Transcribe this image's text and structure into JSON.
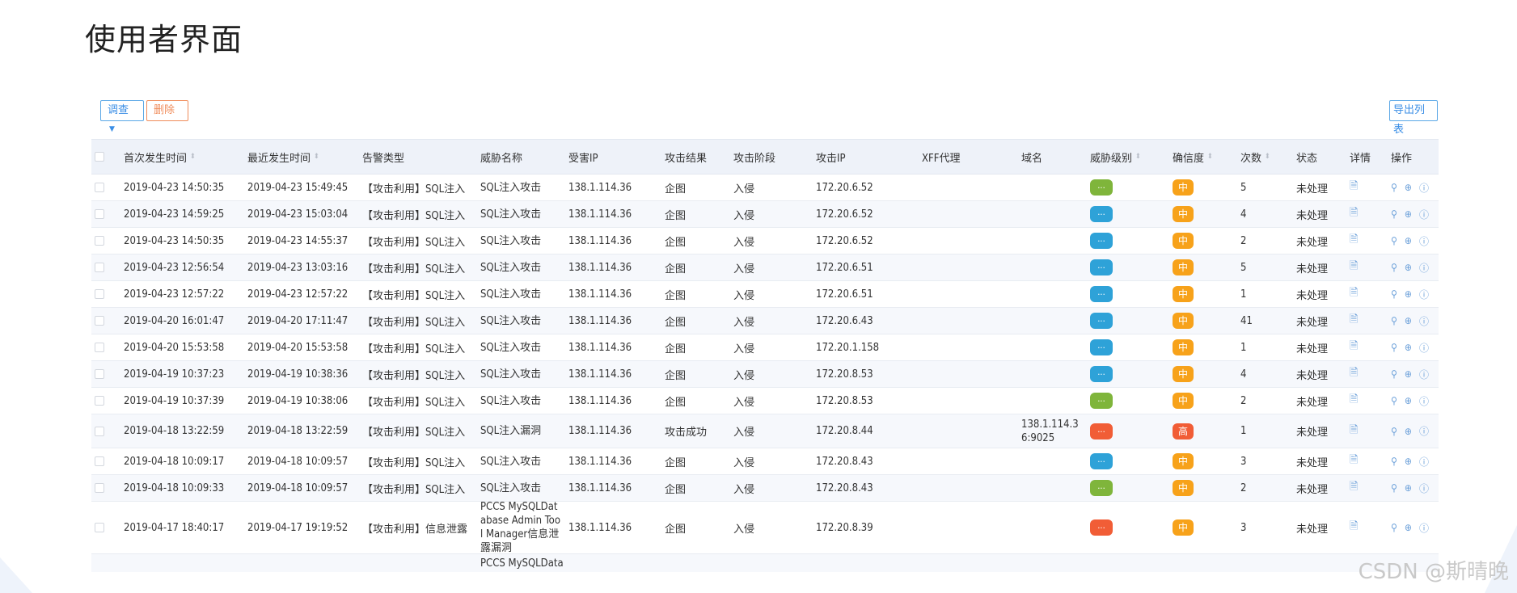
{
  "page_title": "使用者界面",
  "toolbar": {
    "investigate_label": "调查",
    "investigate_caret": "▼",
    "delete_label": "删除",
    "export_label": "导出列表"
  },
  "columns": [
    "首次发生时间",
    "最近发生时间",
    "告警类型",
    "威胁名称",
    "受害IP",
    "攻击结果",
    "攻击阶段",
    "攻击IP",
    "XFF代理",
    "域名",
    "威胁级别",
    "确信度",
    "次数",
    "状态",
    "详情",
    "操作"
  ],
  "colors": {
    "green": "#7fb53b",
    "blue": "#2ea2d8",
    "red": "#f15d36",
    "orange": "#f7a21a",
    "icon": "#6a9fd9"
  },
  "icons": {
    "detail": "document-icon",
    "operations": [
      "search-icon",
      "add-icon",
      "info-icon"
    ]
  },
  "rows": [
    {
      "first": "2019-04-23 14:50:35",
      "last": "2019-04-23 15:49:45",
      "type": "【攻击利用】SQL注入",
      "name": "SQL注入攻击",
      "victim_ip": "138.1.114.36",
      "result": "企图",
      "stage": "入侵",
      "attack_ip": "172.20.6.52",
      "xff": "",
      "domain": "",
      "threat": "...",
      "threat_color": "green",
      "confidence": "中",
      "conf_color": "orange",
      "count": "5",
      "status": "未处理"
    },
    {
      "first": "2019-04-23 14:59:25",
      "last": "2019-04-23 15:03:04",
      "type": "【攻击利用】SQL注入",
      "name": "SQL注入攻击",
      "victim_ip": "138.1.114.36",
      "result": "企图",
      "stage": "入侵",
      "attack_ip": "172.20.6.52",
      "xff": "",
      "domain": "",
      "threat": "...",
      "threat_color": "blue",
      "confidence": "中",
      "conf_color": "orange",
      "count": "4",
      "status": "未处理"
    },
    {
      "first": "2019-04-23 14:50:35",
      "last": "2019-04-23 14:55:37",
      "type": "【攻击利用】SQL注入",
      "name": "SQL注入攻击",
      "victim_ip": "138.1.114.36",
      "result": "企图",
      "stage": "入侵",
      "attack_ip": "172.20.6.52",
      "xff": "",
      "domain": "",
      "threat": "...",
      "threat_color": "blue",
      "confidence": "中",
      "conf_color": "orange",
      "count": "2",
      "status": "未处理"
    },
    {
      "first": "2019-04-23 12:56:54",
      "last": "2019-04-23 13:03:16",
      "type": "【攻击利用】SQL注入",
      "name": "SQL注入攻击",
      "victim_ip": "138.1.114.36",
      "result": "企图",
      "stage": "入侵",
      "attack_ip": "172.20.6.51",
      "xff": "",
      "domain": "",
      "threat": "...",
      "threat_color": "blue",
      "confidence": "中",
      "conf_color": "orange",
      "count": "5",
      "status": "未处理"
    },
    {
      "first": "2019-04-23 12:57:22",
      "last": "2019-04-23 12:57:22",
      "type": "【攻击利用】SQL注入",
      "name": "SQL注入攻击",
      "victim_ip": "138.1.114.36",
      "result": "企图",
      "stage": "入侵",
      "attack_ip": "172.20.6.51",
      "xff": "",
      "domain": "",
      "threat": "...",
      "threat_color": "blue",
      "confidence": "中",
      "conf_color": "orange",
      "count": "1",
      "status": "未处理"
    },
    {
      "first": "2019-04-20 16:01:47",
      "last": "2019-04-20 17:11:47",
      "type": "【攻击利用】SQL注入",
      "name": "SQL注入攻击",
      "victim_ip": "138.1.114.36",
      "result": "企图",
      "stage": "入侵",
      "attack_ip": "172.20.6.43",
      "xff": "",
      "domain": "",
      "threat": "...",
      "threat_color": "blue",
      "confidence": "中",
      "conf_color": "orange",
      "count": "41",
      "status": "未处理"
    },
    {
      "first": "2019-04-20 15:53:58",
      "last": "2019-04-20 15:53:58",
      "type": "【攻击利用】SQL注入",
      "name": "SQL注入攻击",
      "victim_ip": "138.1.114.36",
      "result": "企图",
      "stage": "入侵",
      "attack_ip": "172.20.1.158",
      "xff": "",
      "domain": "",
      "threat": "...",
      "threat_color": "blue",
      "confidence": "中",
      "conf_color": "orange",
      "count": "1",
      "status": "未处理"
    },
    {
      "first": "2019-04-19 10:37:23",
      "last": "2019-04-19 10:38:36",
      "type": "【攻击利用】SQL注入",
      "name": "SQL注入攻击",
      "victim_ip": "138.1.114.36",
      "result": "企图",
      "stage": "入侵",
      "attack_ip": "172.20.8.53",
      "xff": "",
      "domain": "",
      "threat": "...",
      "threat_color": "blue",
      "confidence": "中",
      "conf_color": "orange",
      "count": "4",
      "status": "未处理"
    },
    {
      "first": "2019-04-19 10:37:39",
      "last": "2019-04-19 10:38:06",
      "type": "【攻击利用】SQL注入",
      "name": "SQL注入攻击",
      "victim_ip": "138.1.114.36",
      "result": "企图",
      "stage": "入侵",
      "attack_ip": "172.20.8.53",
      "xff": "",
      "domain": "",
      "threat": "...",
      "threat_color": "green",
      "confidence": "中",
      "conf_color": "orange",
      "count": "2",
      "status": "未处理"
    },
    {
      "first": "2019-04-18 13:22:59",
      "last": "2019-04-18 13:22:59",
      "type": "【攻击利用】SQL注入",
      "name": "SQL注入漏洞",
      "victim_ip": "138.1.114.36",
      "result": "攻击成功",
      "stage": "入侵",
      "attack_ip": "172.20.8.44",
      "xff": "",
      "domain": "138.1.114.36:9025",
      "threat": "...",
      "threat_color": "red",
      "confidence": "高",
      "conf_color": "red",
      "count": "1",
      "status": "未处理"
    },
    {
      "first": "2019-04-18 10:09:17",
      "last": "2019-04-18 10:09:57",
      "type": "【攻击利用】SQL注入",
      "name": "SQL注入攻击",
      "victim_ip": "138.1.114.36",
      "result": "企图",
      "stage": "入侵",
      "attack_ip": "172.20.8.43",
      "xff": "",
      "domain": "",
      "threat": "...",
      "threat_color": "blue",
      "confidence": "中",
      "conf_color": "orange",
      "count": "3",
      "status": "未处理"
    },
    {
      "first": "2019-04-18 10:09:33",
      "last": "2019-04-18 10:09:57",
      "type": "【攻击利用】SQL注入",
      "name": "SQL注入攻击",
      "victim_ip": "138.1.114.36",
      "result": "企图",
      "stage": "入侵",
      "attack_ip": "172.20.8.43",
      "xff": "",
      "domain": "",
      "threat": "...",
      "threat_color": "green",
      "confidence": "中",
      "conf_color": "orange",
      "count": "2",
      "status": "未处理"
    },
    {
      "first": "2019-04-17 18:40:17",
      "last": "2019-04-17 19:19:52",
      "type": "【攻击利用】信息泄露",
      "name": "PCCS MySQLDatabase Admin Tool Manager信息泄露漏洞",
      "victim_ip": "138.1.114.36",
      "result": "企图",
      "stage": "入侵",
      "attack_ip": "172.20.8.39",
      "xff": "",
      "domain": "",
      "threat": "...",
      "threat_color": "red",
      "confidence": "中",
      "conf_color": "orange",
      "count": "3",
      "status": "未处理"
    }
  ],
  "partial_row": {
    "name": "PCCS MySQLData"
  },
  "watermark": "CSDN @斯晴晚"
}
